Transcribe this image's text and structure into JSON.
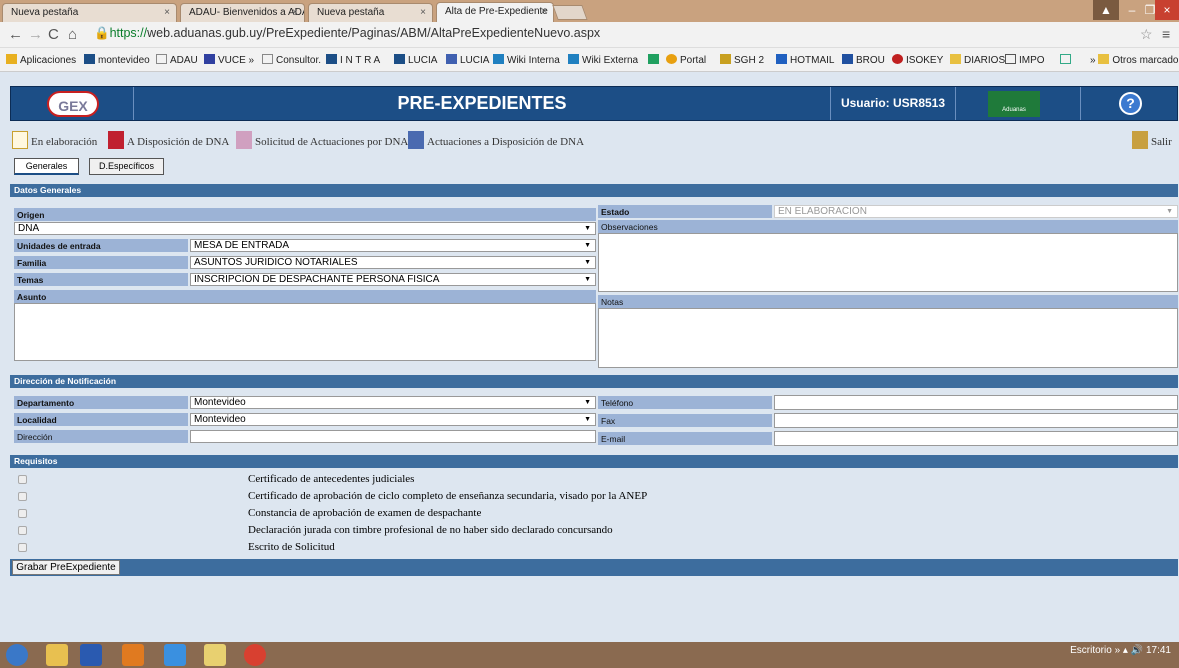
{
  "browser": {
    "tabs": [
      {
        "label": "Nueva pestaña",
        "active": false
      },
      {
        "label": "ADAU- Bienvenidos a ADA",
        "active": false
      },
      {
        "label": "Nueva pestaña",
        "active": false
      },
      {
        "label": "Alta de Pre-Expediente",
        "active": true
      }
    ],
    "url_secure": "https://",
    "url_rest": "web.aduanas.gub.uy/PreExpediente/Paginas/ABM/AltaPreExpedienteNuevo.aspx",
    "bookmarks": [
      "Aplicaciones",
      "montevideo",
      "ADAU",
      "VUCE »",
      "Consultor.",
      "I N T R A",
      "LUCIA",
      "LUCIA",
      "Wiki Interna",
      "Wiki Externa",
      "Portal",
      "SGH 2",
      "HOTMAIL",
      "BROU",
      "ISOKEY",
      "DIARIOS",
      "IMPO"
    ],
    "other_bookmarks": "Otros marcadores"
  },
  "header": {
    "logo": "GEX",
    "title": "PRE-EXPEDIENTES",
    "user": "Usuario: USR8513",
    "brand": "Aduanas",
    "help": "?"
  },
  "toolbar": {
    "items": [
      "En elaboración",
      "A Disposición de DNA",
      "Solicitud de Actuaciones por DNA",
      "Actuaciones a Disposición de DNA"
    ],
    "salir": "Salir"
  },
  "tabs": [
    "Generales",
    "D.Específicos"
  ],
  "datos_generales": {
    "section": "Datos Generales",
    "origen_label": "Origen",
    "origen_value": "DNA",
    "unidades_label": "Unidades de entrada",
    "unidades_value": "MESA DE ENTRADA",
    "familia_label": "Familia",
    "familia_value": "ASUNTOS JURIDICO NOTARIALES",
    "temas_label": "Temas",
    "temas_value": "INSCRIPCION DE DESPACHANTE PERSONA FISICA",
    "asunto_label": "Asunto",
    "estado_label": "Estado",
    "estado_value": "EN ELABORACION",
    "observaciones_label": "Observaciones",
    "notas_label": "Notas"
  },
  "notificacion": {
    "section": "Dirección de Notificación",
    "departamento_label": "Departamento",
    "departamento_value": "Montevideo",
    "localidad_label": "Localidad",
    "localidad_value": "Montevideo",
    "direccion_label": "Dirección",
    "telefono_label": "Teléfono",
    "fax_label": "Fax",
    "email_label": "E-mail"
  },
  "requisitos": {
    "section": "Requisitos",
    "items": [
      "Certificado de antecedentes judiciales",
      "Certificado de aprobación de ciclo completo de enseñanza secundaria, visado por la ANEP",
      "Constancia de aprobación de examen de despachante",
      "Declaración jurada con timbre profesional de no haber sido declarado concursando",
      "Escrito de Solicitud"
    ]
  },
  "grabar_label": "Grabar PreExpediente",
  "taskbar": {
    "desktop": "Escritorio",
    "time": "17:41"
  },
  "colors": {
    "header": "#1c4e86",
    "section": "#3d6d9e",
    "label": "#9cb3d6",
    "page": "#dde6f0"
  }
}
